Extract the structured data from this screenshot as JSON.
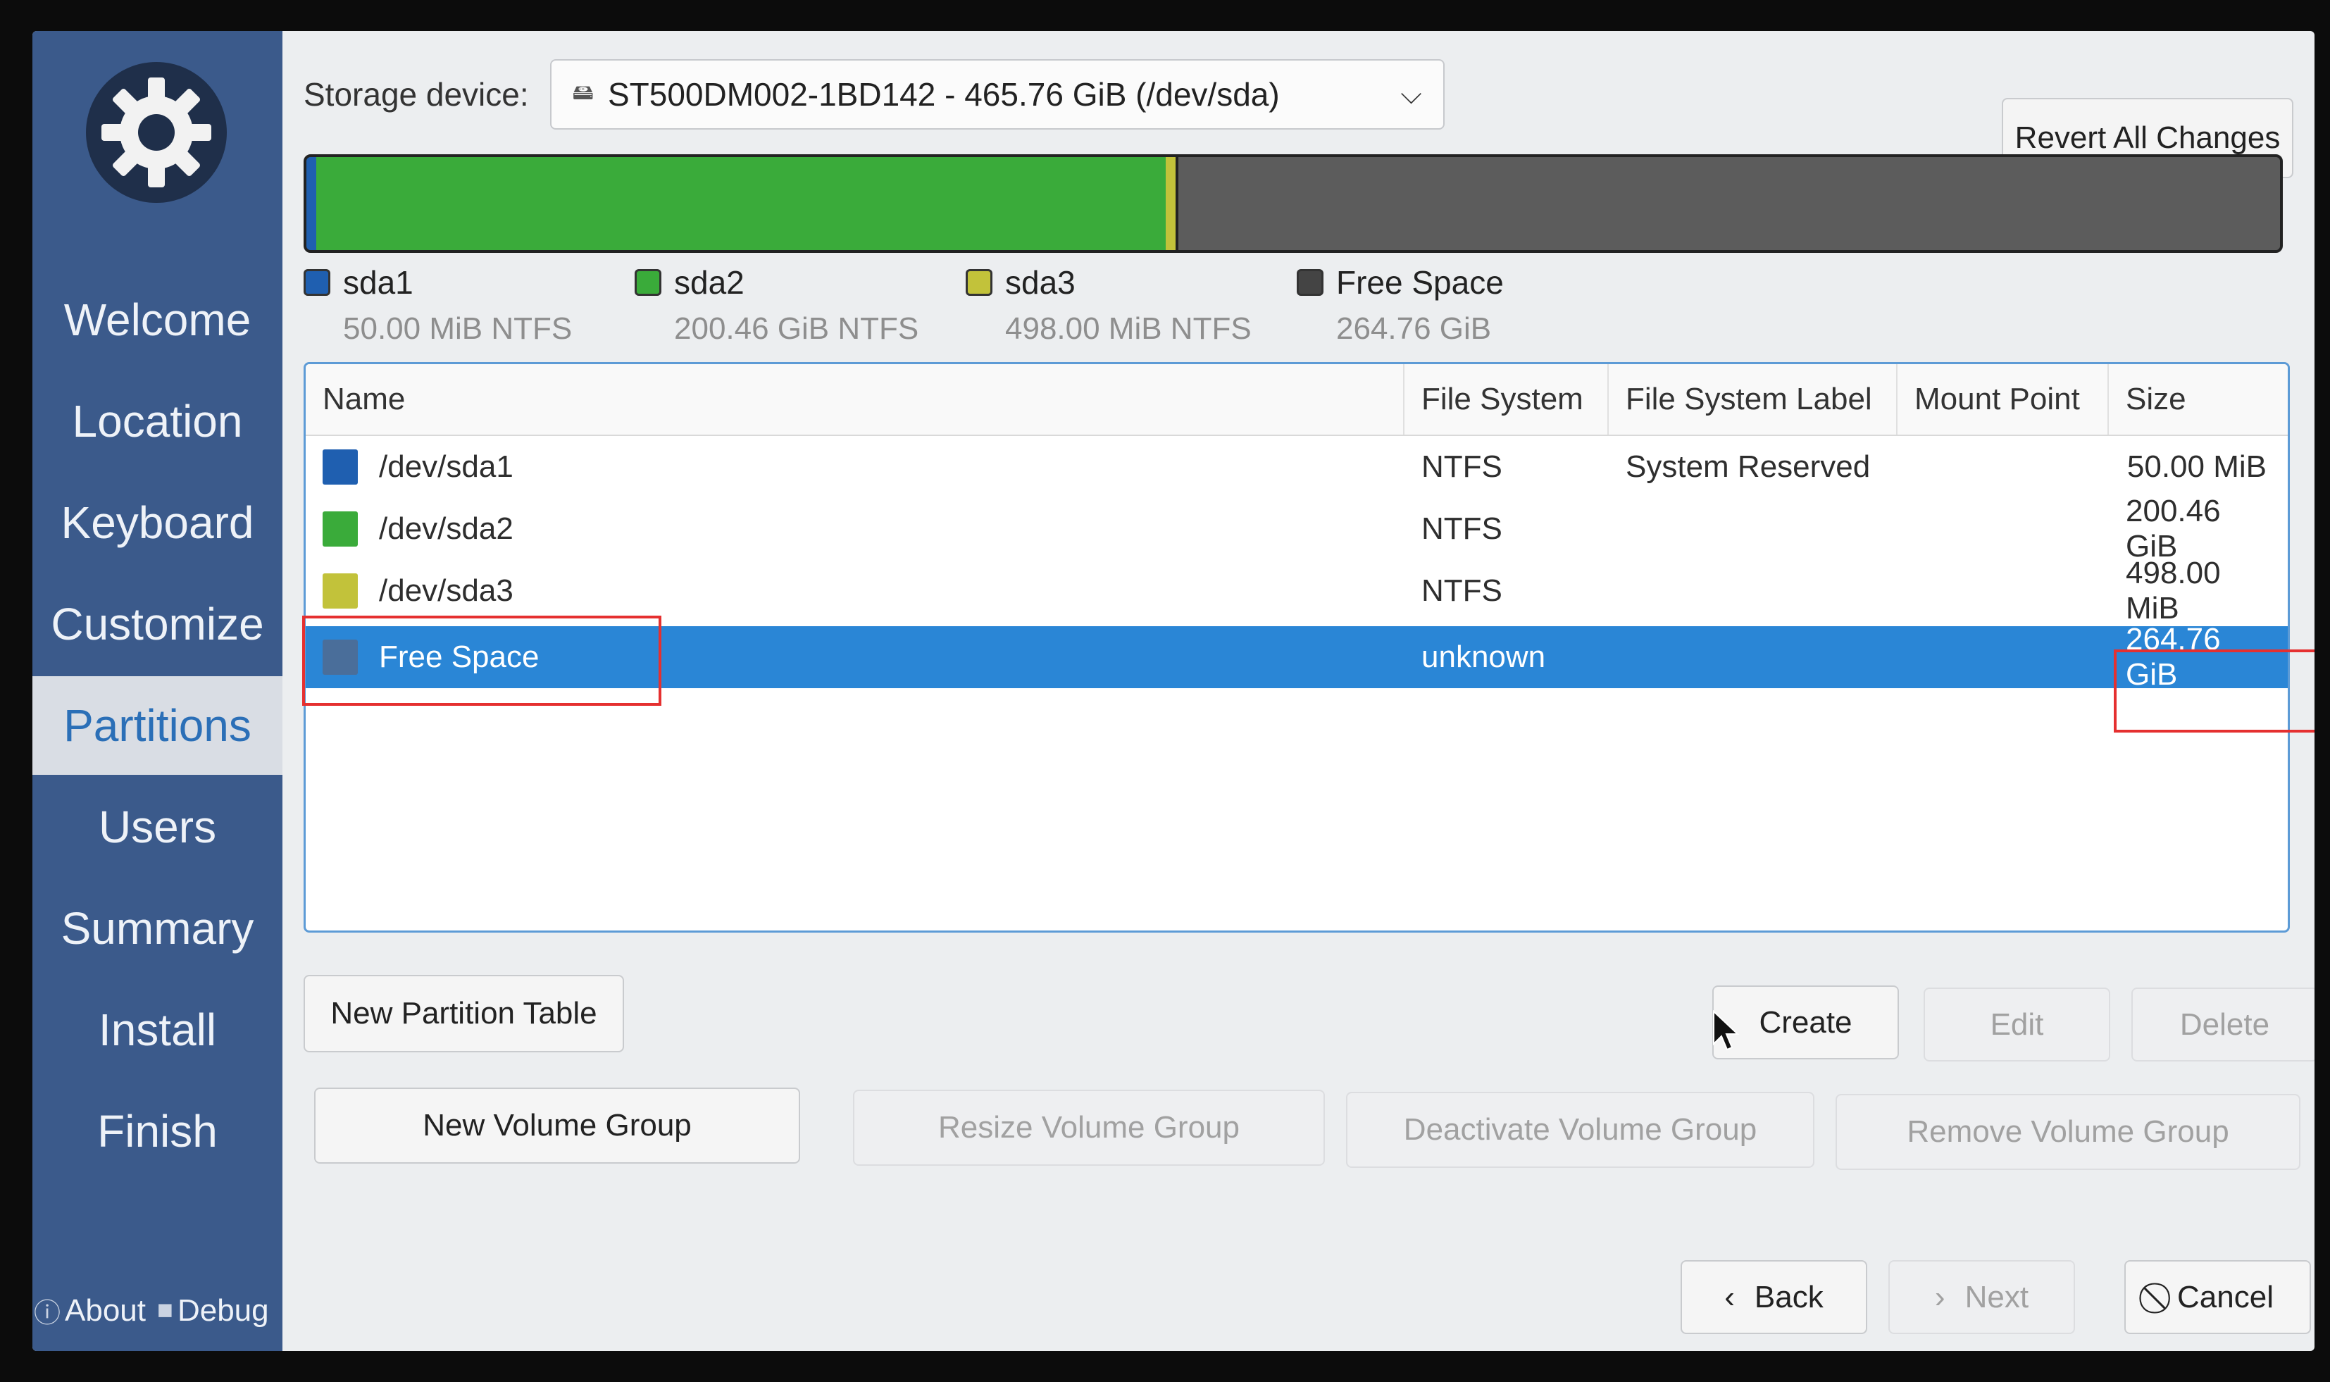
{
  "sidebar": {
    "items": [
      {
        "label": "Welcome"
      },
      {
        "label": "Location"
      },
      {
        "label": "Keyboard"
      },
      {
        "label": "Customize"
      },
      {
        "label": "Partitions"
      },
      {
        "label": "Users"
      },
      {
        "label": "Summary"
      },
      {
        "label": "Install"
      },
      {
        "label": "Finish"
      }
    ],
    "active": "Partitions",
    "footer": {
      "about_label": "About",
      "debug_label": "Debug"
    }
  },
  "storage": {
    "label": "Storage device:",
    "selected": "ST500DM002-1BD142 - 465.76 GiB (/dev/sda)",
    "icon": "disk-icon"
  },
  "revert_label": "Revert All Changes",
  "partition_bar": {
    "segments": [
      {
        "name": "sda1",
        "fraction": 0.0001,
        "color": "#1f5fb0"
      },
      {
        "name": "sda2",
        "fraction": 0.4305,
        "color": "#3aab3a"
      },
      {
        "name": "sda3",
        "fraction": 0.0011,
        "color": "#c2c23a"
      },
      {
        "name": "Free Space",
        "fraction": 0.5684,
        "color": "#5c5c5c"
      }
    ]
  },
  "legend": [
    {
      "name": "sda1",
      "detail": "50.00 MiB  NTFS",
      "color": "#1f5fb0"
    },
    {
      "name": "sda2",
      "detail": "200.46 GiB  NTFS",
      "color": "#3aab3a"
    },
    {
      "name": "sda3",
      "detail": "498.00 MiB  NTFS",
      "color": "#c2c23a"
    },
    {
      "name": "Free Space",
      "detail": "264.76 GiB",
      "color": "#444444"
    }
  ],
  "table": {
    "columns": [
      "Name",
      "File System",
      "File System Label",
      "Mount Point",
      "Size"
    ],
    "rows": [
      {
        "name": "/dev/sda1",
        "fs": "NTFS",
        "label": "System Reserved",
        "mount": "",
        "size": "50.00 MiB",
        "color": "#1f5fb0"
      },
      {
        "name": "/dev/sda2",
        "fs": "NTFS",
        "label": "",
        "mount": "",
        "size": "200.46 GiB",
        "color": "#3aab3a"
      },
      {
        "name": "/dev/sda3",
        "fs": "NTFS",
        "label": "",
        "mount": "",
        "size": "498.00 MiB",
        "color": "#c2c23a"
      },
      {
        "name": "Free Space",
        "fs": "unknown",
        "label": "",
        "mount": "",
        "size": "264.76 GiB",
        "color": "#4a6e9a"
      }
    ],
    "selected_row": "Free Space"
  },
  "buttons": {
    "new_partition_table": "New Partition Table",
    "create": "Create",
    "edit": "Edit",
    "delete": "Delete",
    "new_volume_group": "New Volume Group",
    "resize_volume_group": "Resize Volume Group",
    "deactivate_volume_group": "Deactivate Volume Group",
    "remove_volume_group": "Remove Volume Group",
    "back": "Back",
    "next": "Next",
    "cancel": "Cancel"
  },
  "colors": {
    "sidebar": "#3b5a8b",
    "accent": "#2a86d6",
    "highlight_box": "#e53030"
  }
}
